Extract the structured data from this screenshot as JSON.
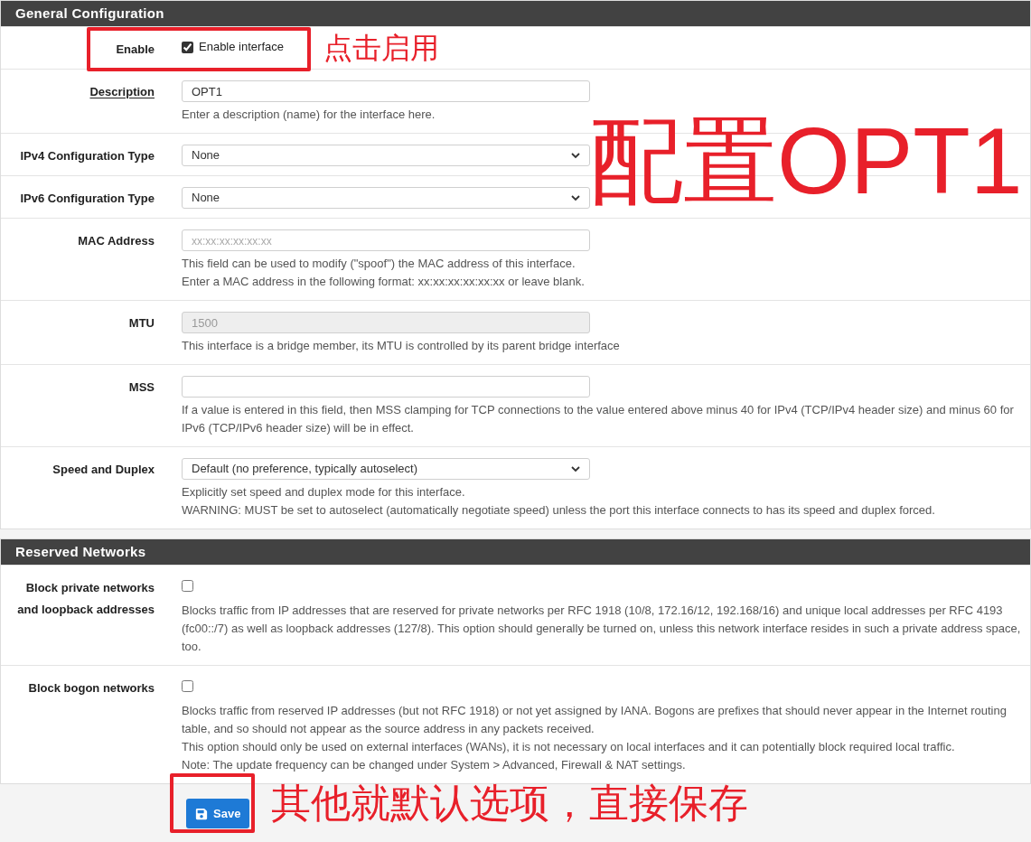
{
  "sections": [
    {
      "title": "General Configuration",
      "rows": [
        {
          "kind": "checkbox",
          "label": "Enable",
          "checkbox_label": "Enable interface",
          "checked": true,
          "help": []
        },
        {
          "kind": "text",
          "label": "Description",
          "label_underlined": true,
          "value": "OPT1",
          "help": [
            "Enter a description (name) for the interface here."
          ]
        },
        {
          "kind": "select",
          "label": "IPv4 Configuration Type",
          "value": "None",
          "help": []
        },
        {
          "kind": "select",
          "label": "IPv6 Configuration Type",
          "value": "None",
          "help": []
        },
        {
          "kind": "text",
          "label": "MAC Address",
          "placeholder": "xx:xx:xx:xx:xx:xx",
          "help": [
            "This field can be used to modify (\"spoof\") the MAC address of this interface.",
            "Enter a MAC address in the following format: xx:xx:xx:xx:xx:xx or leave blank."
          ]
        },
        {
          "kind": "text",
          "label": "MTU",
          "value": "1500",
          "disabled": true,
          "help": [
            "This interface is a bridge member, its MTU is controlled by its parent bridge interface"
          ]
        },
        {
          "kind": "text",
          "label": "MSS",
          "help": [
            "If a value is entered in this field, then MSS clamping for TCP connections to the value entered above minus 40 for IPv4 (TCP/IPv4 header size) and minus 60 for IPv6 (TCP/IPv6 header size) will be in effect."
          ]
        },
        {
          "kind": "select",
          "label": "Speed and Duplex",
          "value": "Default (no preference, typically autoselect)",
          "help": [
            "Explicitly set speed and duplex mode for this interface.",
            "WARNING: MUST be set to autoselect (automatically negotiate speed) unless the port this interface connects to has its speed and duplex forced."
          ]
        }
      ]
    },
    {
      "title": "Reserved Networks",
      "rows": [
        {
          "kind": "checkbox",
          "label": "Block private networks and loopback addresses",
          "checked": false,
          "help": [
            "Blocks traffic from IP addresses that are reserved for private networks per RFC 1918 (10/8, 172.16/12, 192.168/16) and unique local addresses per RFC 4193 (fc00::/7) as well as loopback addresses (127/8). This option should generally be turned on, unless this network interface resides in such a private address space, too."
          ]
        },
        {
          "kind": "checkbox",
          "label": "Block bogon networks",
          "checked": false,
          "help": [
            "Blocks traffic from reserved IP addresses (but not RFC 1918) or not yet assigned by IANA. Bogons are prefixes that should never appear in the Internet routing table, and so should not appear as the source address in any packets received.",
            "This option should only be used on external interfaces (WANs), it is not necessary on local interfaces and it can potentially block required local traffic.",
            "Note: The update frequency can be changed under System > Advanced, Firewall & NAT settings."
          ]
        }
      ]
    }
  ],
  "save_button": "Save",
  "annotations": {
    "enable_note": "点击启用",
    "title_note": "配置OPT1",
    "save_note": "其他就默认选项，直接保存"
  }
}
